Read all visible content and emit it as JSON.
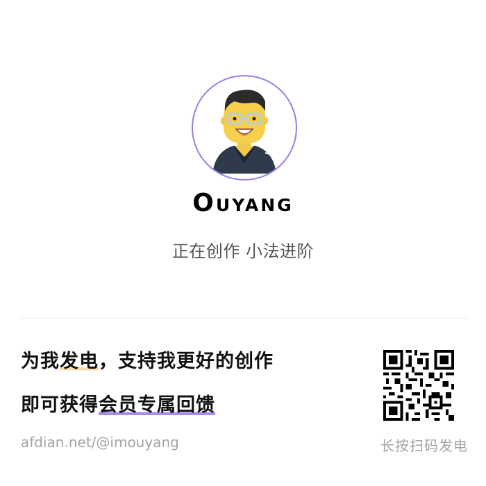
{
  "profile": {
    "name": "Ouyang",
    "tagline": "正在创作 小法进阶"
  },
  "promo": {
    "line1_pre": "为我",
    "line1_hl": "发电",
    "line1_post": "，支持我更好的创作",
    "line2_pre": "即可获得",
    "line2_hl": "会员专属回馈"
  },
  "footer": {
    "url": "afdian.net/@imouyang",
    "scan_hint": "长按扫码发电"
  },
  "colors": {
    "avatar_ring": "#9a7ce6",
    "highlight_orange": "#fbdcb0",
    "highlight_purple": "#a88ce8",
    "muted_text": "#a3a3a3"
  },
  "icons": {
    "avatar": "cartoon-avatar",
    "qr": "qr-code"
  }
}
